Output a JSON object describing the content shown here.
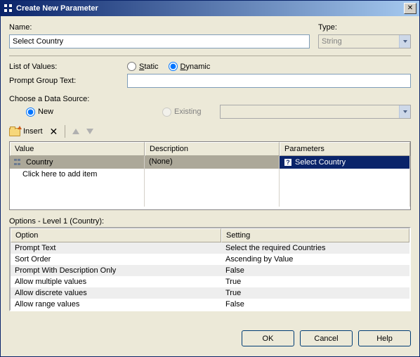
{
  "titlebar": {
    "text": "Create New Parameter"
  },
  "name": {
    "label": "Name:",
    "value": "Select Country"
  },
  "type": {
    "label": "Type:",
    "value": "String"
  },
  "listOfValues": {
    "label": "List of Values:",
    "static": "Static",
    "dynamic": "Dynamic"
  },
  "promptGroup": {
    "label": "Prompt Group Text:",
    "value": ""
  },
  "dataSource": {
    "label": "Choose a Data Source:",
    "new": "New",
    "existing": "Existing",
    "comboValue": ""
  },
  "toolbar": {
    "insert": "Insert"
  },
  "grid": {
    "headers": {
      "value": "Value",
      "description": "Description",
      "parameters": "Parameters"
    },
    "rows": [
      {
        "value": "Country",
        "description": "(None)",
        "parameter": "Select Country"
      }
    ],
    "addItem": "Click here to add item"
  },
  "options": {
    "title": "Options - Level 1 (Country):",
    "headers": {
      "option": "Option",
      "setting": "Setting"
    },
    "rows": [
      {
        "option": "Prompt Text",
        "setting": "Select the required Countries"
      },
      {
        "option": "Sort Order",
        "setting": "Ascending by Value"
      },
      {
        "option": "Prompt With Description Only",
        "setting": "False"
      },
      {
        "option": "Allow multiple values",
        "setting": "True"
      },
      {
        "option": "Allow discrete values",
        "setting": "True"
      },
      {
        "option": "Allow range values",
        "setting": "False"
      }
    ]
  },
  "buttons": {
    "ok": "OK",
    "cancel": "Cancel",
    "help": "Help"
  }
}
